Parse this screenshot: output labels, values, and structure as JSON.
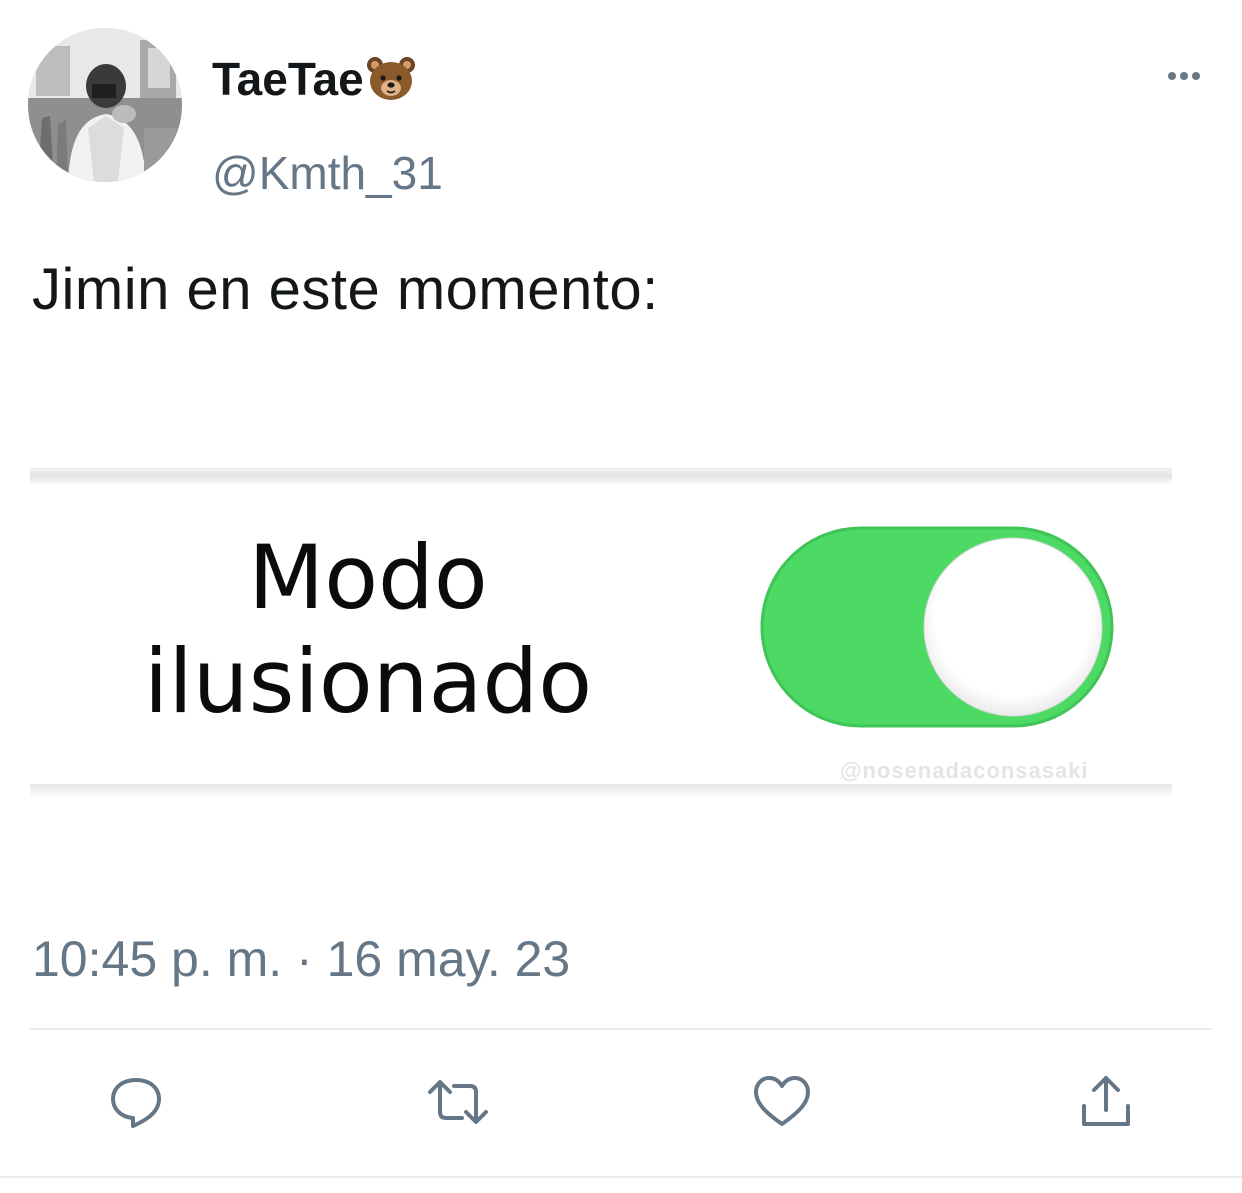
{
  "tweet": {
    "display_name": "TaeTae",
    "display_emoji": "bear-face-emoji",
    "handle": "@Kmth_31",
    "text": "Jimin en este momento:",
    "timestamp": "10:45 p. m. · 16 may. 23"
  },
  "media": {
    "caption_line1": "Modo",
    "caption_line2": "ilusionado",
    "toggle_state": "on",
    "watermark": "@nosenadaconsasaki",
    "toggle_color": "#4cd964"
  },
  "actions": {
    "reply_icon": "speech-bubble-icon",
    "retweet_icon": "retweet-icon",
    "like_icon": "heart-icon",
    "share_icon": "share-icon"
  },
  "colors": {
    "text_primary": "#14171a",
    "text_secondary": "#657786",
    "icon": "#657786",
    "divider": "#e6ecf0"
  }
}
